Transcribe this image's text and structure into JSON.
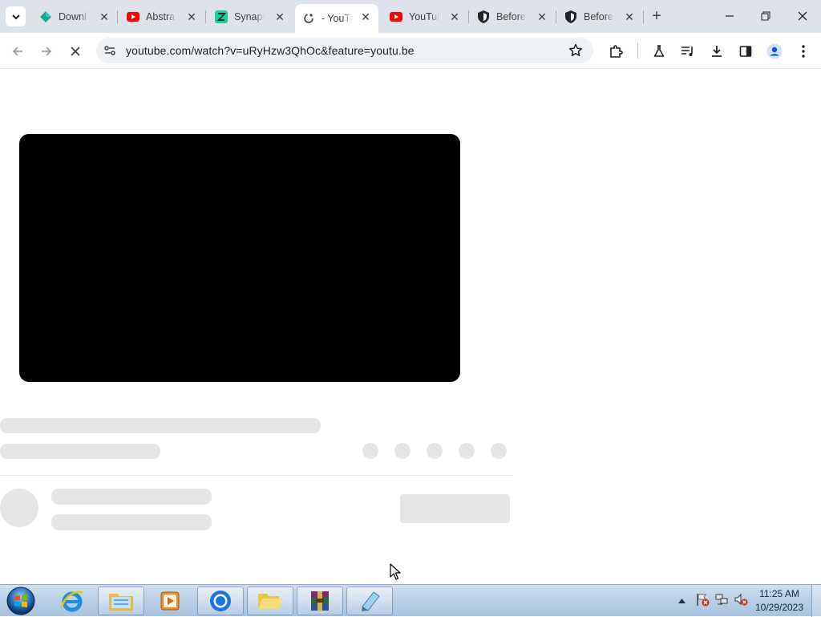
{
  "browser": {
    "tabs": [
      {
        "title": "Downl",
        "icon": "diamond-icon",
        "active": false
      },
      {
        "title": "Abstra",
        "icon": "youtube-icon",
        "active": false
      },
      {
        "title": "Synaps",
        "icon": "synapse-icon",
        "active": false
      },
      {
        "title": "- YouTu",
        "icon": "loading-icon",
        "active": true
      },
      {
        "title": "YouTul",
        "icon": "youtube-icon",
        "active": false
      },
      {
        "title": "Before",
        "icon": "shield-icon",
        "active": false
      },
      {
        "title": "Before",
        "icon": "shield-icon",
        "active": false
      }
    ],
    "url": "youtube.com/watch?v=uRyHzw3QhOc&feature=youtu.be",
    "new_tab_symbol": "+"
  },
  "taskbar": {
    "items": [
      "start-orb",
      "internet-explorer",
      "file-explorer",
      "media-player",
      "chrome",
      "folder",
      "winrar",
      "notepad"
    ],
    "clock_time": "11:25 AM",
    "clock_date": "10/29/2023"
  },
  "colors": {
    "tabstrip": "#dee3eb",
    "player": "#000000",
    "skeleton": "#e5e5e5",
    "youtube_red": "#ff0000"
  }
}
